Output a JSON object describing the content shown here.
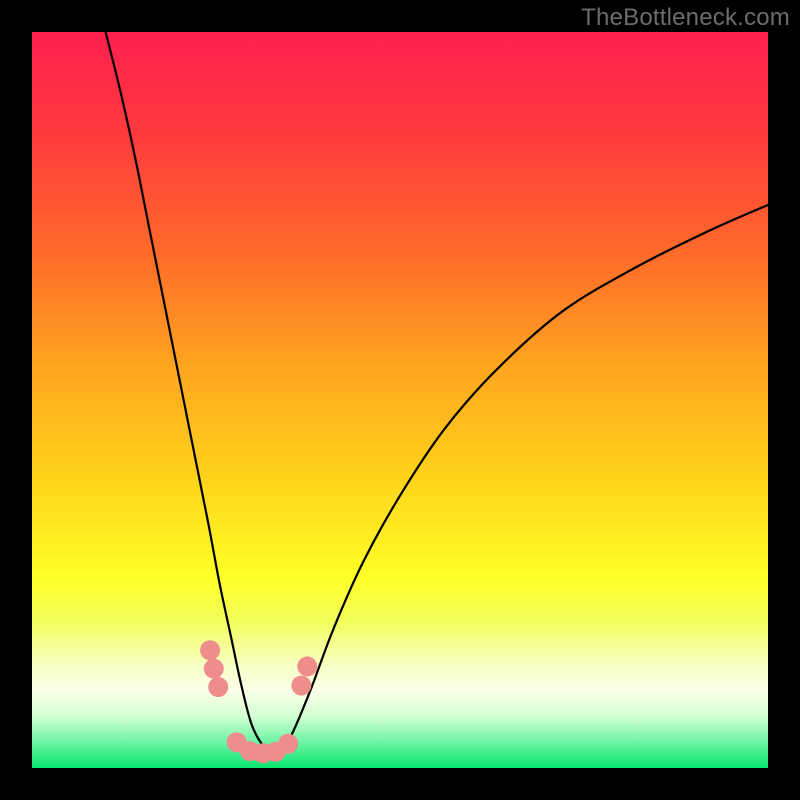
{
  "watermark": "TheBottleneck.com",
  "chart_data": {
    "type": "line",
    "title": "",
    "xlabel": "",
    "ylabel": "",
    "xlim": [
      0,
      100
    ],
    "ylim": [
      0,
      100
    ],
    "gradient_stops": [
      {
        "pos": 0.0,
        "color": "#ff1f4f"
      },
      {
        "pos": 0.14,
        "color": "#ff3a3d"
      },
      {
        "pos": 0.3,
        "color": "#ff6a2a"
      },
      {
        "pos": 0.45,
        "color": "#ffa41f"
      },
      {
        "pos": 0.6,
        "color": "#ffd11a"
      },
      {
        "pos": 0.74,
        "color": "#ffff26"
      },
      {
        "pos": 0.8,
        "color": "#f3ff5a"
      },
      {
        "pos": 0.86,
        "color": "#f8ffc4"
      },
      {
        "pos": 0.895,
        "color": "#fbffe8"
      },
      {
        "pos": 0.93,
        "color": "#d3ffd3"
      },
      {
        "pos": 0.965,
        "color": "#6cf3a3"
      },
      {
        "pos": 1.0,
        "color": "#09e76f"
      }
    ],
    "series": [
      {
        "name": "curve",
        "x": [
          10,
          12,
          14,
          16,
          18,
          20,
          22,
          24,
          25.5,
          27,
          28.5,
          30,
          32,
          34,
          35.5,
          38,
          41,
          45,
          50,
          56,
          63,
          72,
          82,
          92,
          100
        ],
        "y": [
          100,
          92,
          83,
          73,
          63,
          53,
          43,
          33,
          25,
          18,
          11,
          5.5,
          2.5,
          2.5,
          5,
          11,
          19,
          28,
          37,
          46,
          54,
          62,
          68,
          73,
          76.5
        ]
      }
    ],
    "markers": {
      "name": "highlight-dots",
      "color": "#ef8d8c",
      "radius_px": 10,
      "points": [
        {
          "x": 24.2,
          "y": 16.0
        },
        {
          "x": 24.7,
          "y": 13.5
        },
        {
          "x": 25.3,
          "y": 11.0
        },
        {
          "x": 27.8,
          "y": 3.5
        },
        {
          "x": 29.6,
          "y": 2.3
        },
        {
          "x": 31.4,
          "y": 2.0
        },
        {
          "x": 33.1,
          "y": 2.2
        },
        {
          "x": 34.8,
          "y": 3.3
        },
        {
          "x": 36.6,
          "y": 11.2
        },
        {
          "x": 37.4,
          "y": 13.8
        }
      ]
    }
  }
}
